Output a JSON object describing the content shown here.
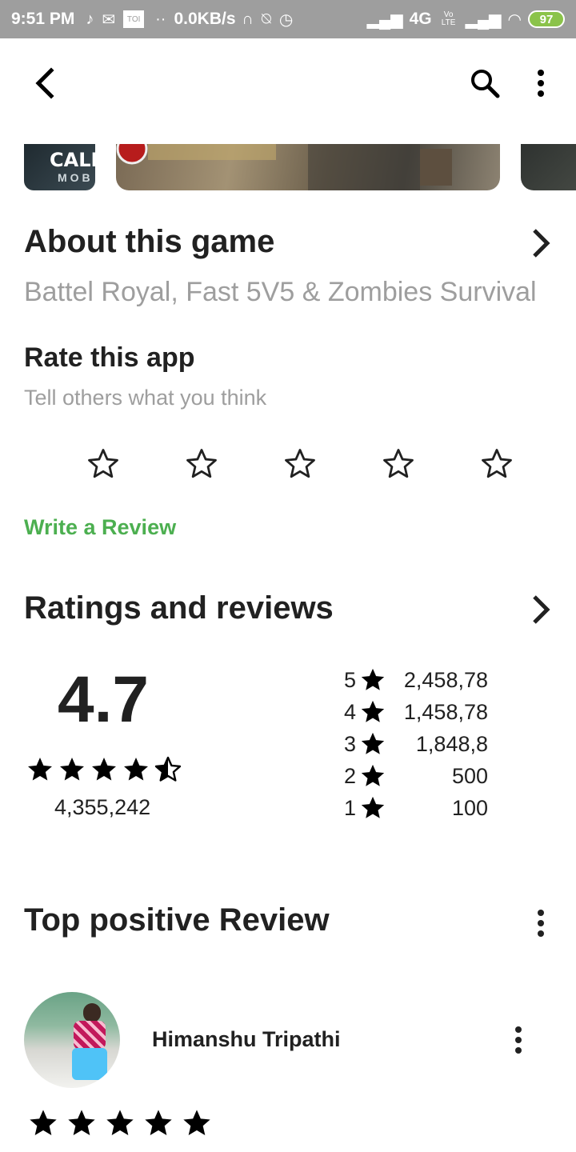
{
  "status_bar": {
    "time": "9:51 PM",
    "toi_badge": "TOI",
    "speed": "0.0KB/s",
    "network": "4G",
    "volte": "Vo LTE",
    "battery": "97"
  },
  "toolbar": {
    "back_icon": "back-arrow-icon",
    "search_icon": "search-icon",
    "more_icon": "more-vert-icon"
  },
  "screenshots": {
    "first_logo_line1": "CALL",
    "first_logo_line2": "MOB"
  },
  "about": {
    "title": "About this game",
    "description": "Battel Royal, Fast 5V5 & Zombies Survival"
  },
  "rate": {
    "title": "Rate this app",
    "subtitle": "Tell others what you think",
    "star_count": 5,
    "write_review_label": "Write a Review"
  },
  "ratings": {
    "title": "Ratings and reviews",
    "average": "4.7",
    "average_value": 4.7,
    "total_count": "4,355,242",
    "distribution": [
      {
        "stars": "5",
        "count": "2,458,78"
      },
      {
        "stars": "4",
        "count": "1,458,78"
      },
      {
        "stars": "3",
        "count": "1,848,8"
      },
      {
        "stars": "2",
        "count": "500"
      },
      {
        "stars": "1",
        "count": "100"
      }
    ]
  },
  "top_review": {
    "title": "Top positive Review",
    "reviewer_name": "Himanshu Tripathi",
    "rating": 5
  },
  "colors": {
    "accent_green": "#4caf50",
    "text_primary": "#212121",
    "text_secondary": "#9e9e9e",
    "status_bar": "#9e9e9e"
  }
}
